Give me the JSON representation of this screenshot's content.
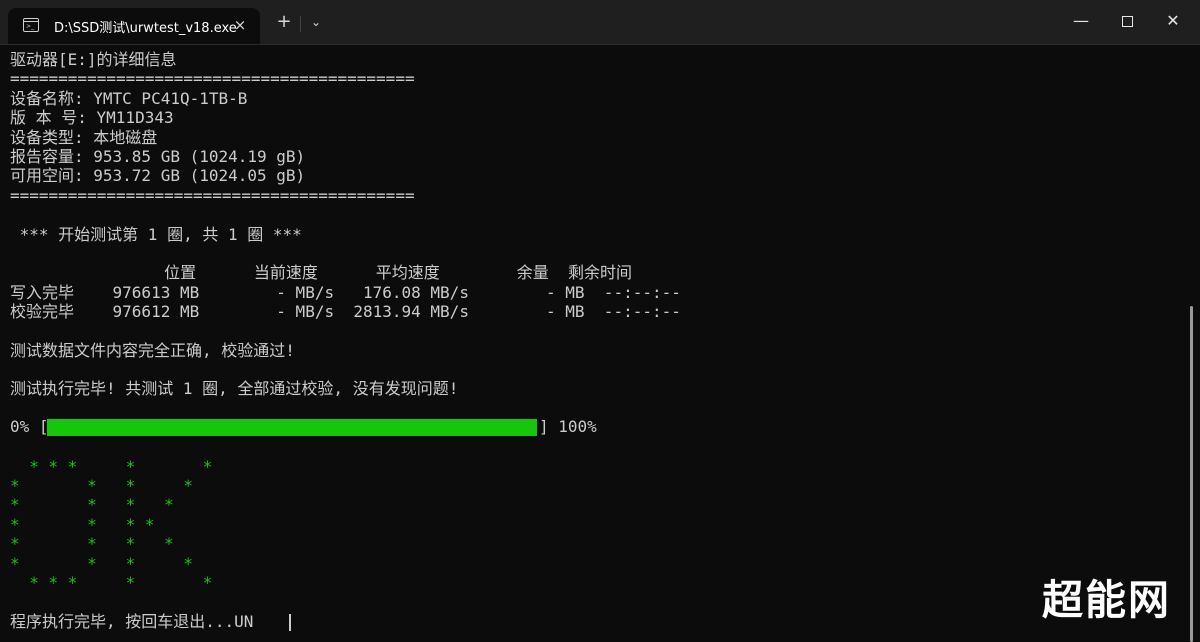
{
  "window": {
    "tab_title": "D:\\SSD测试\\urwtest_v18.exe",
    "tab_icon": "terminal-icon",
    "tab_close": "×",
    "new_tab": "+",
    "dropdown": "⌄",
    "minimize": "—",
    "close": "✕"
  },
  "console": {
    "drive_header": "驱动器[E:]的详细信息",
    "rule": "==========================================",
    "device_name": "设备名称: YMTC PC41Q-1TB-B",
    "version": "版 本 号: YM11D343",
    "device_type": "设备类型: 本地磁盘",
    "reported_capacity": "报告容量: 953.85 GB (1024.19 gB)",
    "free_space": "可用空间: 953.72 GB (1024.05 gB)",
    "test_start": " *** 开始测试第 1 圈, 共 1 圈 ***",
    "table_header": "                位置      当前速度      平均速度        余量  剩余时间",
    "row_write": "写入完毕    976613 MB        - MB/s   176.08 MB/s        - MB  --:--:--",
    "row_verify": "校验完毕    976612 MB        - MB/s  2813.94 MB/s        - MB  --:--:--",
    "verify_ok": "测试数据文件内容完全正确, 校验通过!",
    "test_done": "测试执行完毕! 共测试 1 圈, 全部通过校验, 没有发现问题!",
    "progress_left": "0% [",
    "progress_right": "] 100%",
    "progress_fraction": 1.0,
    "ok_art": [
      "  * * *     *       *",
      "*       *   *     *",
      "*       *   *   *",
      "*       *   * *",
      "*       *   *   *",
      "*       *   *     *",
      "  * * *     *       *"
    ],
    "exit_prompt": "程序执行完毕, 按回车退出...UN"
  },
  "watermark": "超能网",
  "colors": {
    "background": "#0c0c0c",
    "text": "#cccccc",
    "accent_green": "#16c60c"
  }
}
